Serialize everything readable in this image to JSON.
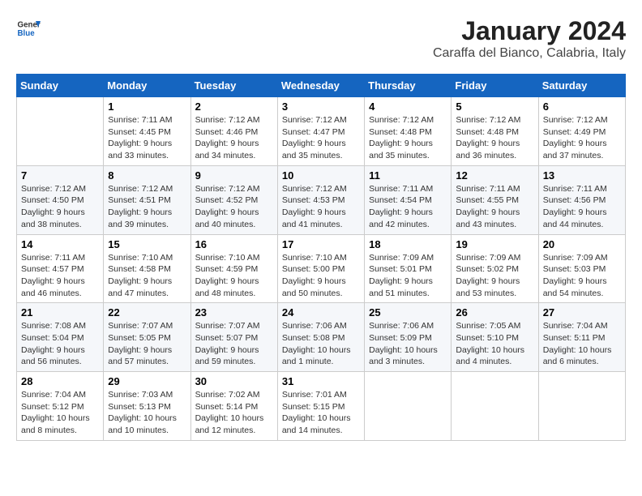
{
  "logo": {
    "line1": "General",
    "line2": "Blue"
  },
  "title": "January 2024",
  "subtitle": "Caraffa del Bianco, Calabria, Italy",
  "columns": [
    "Sunday",
    "Monday",
    "Tuesday",
    "Wednesday",
    "Thursday",
    "Friday",
    "Saturday"
  ],
  "weeks": [
    [
      {
        "day": "",
        "info": ""
      },
      {
        "day": "1",
        "info": "Sunrise: 7:11 AM\nSunset: 4:45 PM\nDaylight: 9 hours\nand 33 minutes."
      },
      {
        "day": "2",
        "info": "Sunrise: 7:12 AM\nSunset: 4:46 PM\nDaylight: 9 hours\nand 34 minutes."
      },
      {
        "day": "3",
        "info": "Sunrise: 7:12 AM\nSunset: 4:47 PM\nDaylight: 9 hours\nand 35 minutes."
      },
      {
        "day": "4",
        "info": "Sunrise: 7:12 AM\nSunset: 4:48 PM\nDaylight: 9 hours\nand 35 minutes."
      },
      {
        "day": "5",
        "info": "Sunrise: 7:12 AM\nSunset: 4:48 PM\nDaylight: 9 hours\nand 36 minutes."
      },
      {
        "day": "6",
        "info": "Sunrise: 7:12 AM\nSunset: 4:49 PM\nDaylight: 9 hours\nand 37 minutes."
      }
    ],
    [
      {
        "day": "7",
        "info": "Sunrise: 7:12 AM\nSunset: 4:50 PM\nDaylight: 9 hours\nand 38 minutes."
      },
      {
        "day": "8",
        "info": "Sunrise: 7:12 AM\nSunset: 4:51 PM\nDaylight: 9 hours\nand 39 minutes."
      },
      {
        "day": "9",
        "info": "Sunrise: 7:12 AM\nSunset: 4:52 PM\nDaylight: 9 hours\nand 40 minutes."
      },
      {
        "day": "10",
        "info": "Sunrise: 7:12 AM\nSunset: 4:53 PM\nDaylight: 9 hours\nand 41 minutes."
      },
      {
        "day": "11",
        "info": "Sunrise: 7:11 AM\nSunset: 4:54 PM\nDaylight: 9 hours\nand 42 minutes."
      },
      {
        "day": "12",
        "info": "Sunrise: 7:11 AM\nSunset: 4:55 PM\nDaylight: 9 hours\nand 43 minutes."
      },
      {
        "day": "13",
        "info": "Sunrise: 7:11 AM\nSunset: 4:56 PM\nDaylight: 9 hours\nand 44 minutes."
      }
    ],
    [
      {
        "day": "14",
        "info": "Sunrise: 7:11 AM\nSunset: 4:57 PM\nDaylight: 9 hours\nand 46 minutes."
      },
      {
        "day": "15",
        "info": "Sunrise: 7:10 AM\nSunset: 4:58 PM\nDaylight: 9 hours\nand 47 minutes."
      },
      {
        "day": "16",
        "info": "Sunrise: 7:10 AM\nSunset: 4:59 PM\nDaylight: 9 hours\nand 48 minutes."
      },
      {
        "day": "17",
        "info": "Sunrise: 7:10 AM\nSunset: 5:00 PM\nDaylight: 9 hours\nand 50 minutes."
      },
      {
        "day": "18",
        "info": "Sunrise: 7:09 AM\nSunset: 5:01 PM\nDaylight: 9 hours\nand 51 minutes."
      },
      {
        "day": "19",
        "info": "Sunrise: 7:09 AM\nSunset: 5:02 PM\nDaylight: 9 hours\nand 53 minutes."
      },
      {
        "day": "20",
        "info": "Sunrise: 7:09 AM\nSunset: 5:03 PM\nDaylight: 9 hours\nand 54 minutes."
      }
    ],
    [
      {
        "day": "21",
        "info": "Sunrise: 7:08 AM\nSunset: 5:04 PM\nDaylight: 9 hours\nand 56 minutes."
      },
      {
        "day": "22",
        "info": "Sunrise: 7:07 AM\nSunset: 5:05 PM\nDaylight: 9 hours\nand 57 minutes."
      },
      {
        "day": "23",
        "info": "Sunrise: 7:07 AM\nSunset: 5:07 PM\nDaylight: 9 hours\nand 59 minutes."
      },
      {
        "day": "24",
        "info": "Sunrise: 7:06 AM\nSunset: 5:08 PM\nDaylight: 10 hours\nand 1 minute."
      },
      {
        "day": "25",
        "info": "Sunrise: 7:06 AM\nSunset: 5:09 PM\nDaylight: 10 hours\nand 3 minutes."
      },
      {
        "day": "26",
        "info": "Sunrise: 7:05 AM\nSunset: 5:10 PM\nDaylight: 10 hours\nand 4 minutes."
      },
      {
        "day": "27",
        "info": "Sunrise: 7:04 AM\nSunset: 5:11 PM\nDaylight: 10 hours\nand 6 minutes."
      }
    ],
    [
      {
        "day": "28",
        "info": "Sunrise: 7:04 AM\nSunset: 5:12 PM\nDaylight: 10 hours\nand 8 minutes."
      },
      {
        "day": "29",
        "info": "Sunrise: 7:03 AM\nSunset: 5:13 PM\nDaylight: 10 hours\nand 10 minutes."
      },
      {
        "day": "30",
        "info": "Sunrise: 7:02 AM\nSunset: 5:14 PM\nDaylight: 10 hours\nand 12 minutes."
      },
      {
        "day": "31",
        "info": "Sunrise: 7:01 AM\nSunset: 5:15 PM\nDaylight: 10 hours\nand 14 minutes."
      },
      {
        "day": "",
        "info": ""
      },
      {
        "day": "",
        "info": ""
      },
      {
        "day": "",
        "info": ""
      }
    ]
  ]
}
